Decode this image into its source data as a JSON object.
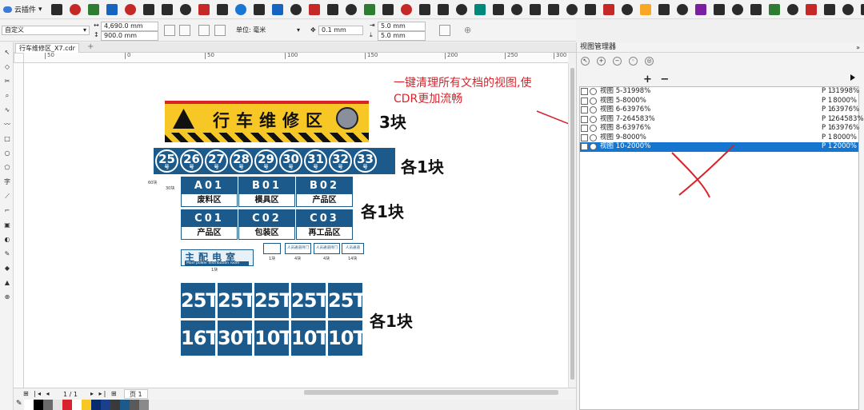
{
  "toolbar": {
    "plugin_label": "云插件",
    "icon_colors": [
      "#2b2b2b",
      "#c62828",
      "#2e7d32",
      "#1565c0",
      "#c62828",
      "#2b2b2b",
      "#2b2b2b",
      "#2b2b2b",
      "#c62828",
      "#2b2b2b",
      "#1976d2",
      "#2b2b2b",
      "#1565c0",
      "#2b2b2b",
      "#c62828",
      "#2b2b2b",
      "#2b2b2b",
      "#2e7d32",
      "#2b2b2b",
      "#c62828",
      "#2b2b2b",
      "#2b2b2b",
      "#2b2b2b",
      "#00897b",
      "#2b2b2b",
      "#2b2b2b",
      "#2b2b2b",
      "#2b2b2b",
      "#2b2b2b",
      "#2b2b2b",
      "#c62828",
      "#2b2b2b",
      "#f9a825",
      "#2b2b2b",
      "#2b2b2b",
      "#7b1fa2",
      "#2b2b2b",
      "#2b2b2b",
      "#2b2b2b",
      "#2e7d32",
      "#2b2b2b",
      "#c62828",
      "#2b2b2b",
      "#2b2b2b",
      "#2b2b2b",
      "#2b2b2b",
      "#2b2b2b",
      "#c62828"
    ]
  },
  "propbar": {
    "preset": "自定义",
    "width": "4,690.0 mm",
    "height": "900.0 mm",
    "unit_label": "单位: 毫米",
    "nudge": "0.1 mm",
    "dup_x": "5.0 mm",
    "dup_y": "5.0 mm"
  },
  "document": {
    "tab": "行车维修区_X7.cdr",
    "ruler_ticks": [
      "50",
      "0",
      "50",
      "100",
      "150",
      "200",
      "250",
      "300"
    ],
    "page_info": "1 / 1",
    "page_tab": "页 1"
  },
  "artwork": {
    "banner_title": "行车维修区",
    "banner_count": "3块",
    "numbers": [
      "25",
      "26",
      "27",
      "28",
      "29",
      "30",
      "31",
      "32",
      "33"
    ],
    "number_suffix": "号",
    "numbers_count": "各1块",
    "mini_left": "60块",
    "mini_right": "30块",
    "plaques": [
      {
        "code": "A01",
        "name": "废料区"
      },
      {
        "code": "B01",
        "name": "模具区"
      },
      {
        "code": "B02",
        "name": "产品区"
      },
      {
        "code": "C01",
        "name": "产品区"
      },
      {
        "code": "C02",
        "name": "包装区"
      },
      {
        "code": "C03",
        "name": "再工品区"
      }
    ],
    "plaques_count": "各1块",
    "power_room_title": "主配电室",
    "power_room_sub": "Main power distribution room",
    "power_room_count": "1块",
    "small_signs": [
      {
        "text": "",
        "count": "1块"
      },
      {
        "text": "人员通道持门",
        "count": "4块"
      },
      {
        "text": "人员通道持门",
        "count": "4块"
      },
      {
        "text": "人员通道",
        "count": "14块"
      }
    ],
    "tonnage": [
      "25T",
      "25T",
      "25T",
      "25T",
      "25T",
      "16T",
      "30T",
      "10T",
      "10T",
      "10T"
    ],
    "tonnage_count": "各1块"
  },
  "annotation": {
    "text": "一键清理所有文档的视图,使CDR更加流畅",
    "color": "#d8232a"
  },
  "docker": {
    "title": "视图管理器",
    "add_remove": "+ −",
    "views": [
      {
        "name": "视图 5-31998%",
        "page": "P 1",
        "zoom": "31998%",
        "selected": false
      },
      {
        "name": "视图 5-8000%",
        "page": "P 1",
        "zoom": "8000%",
        "selected": false
      },
      {
        "name": "视图 6-63976%",
        "page": "P 1",
        "zoom": "63976%",
        "selected": false
      },
      {
        "name": "视图 7-264583%",
        "page": "P 1",
        "zoom": "264583%",
        "selected": false
      },
      {
        "name": "视图 8-63976%",
        "page": "P 1",
        "zoom": "63976%",
        "selected": false
      },
      {
        "name": "视图 9-8000%",
        "page": "P 1",
        "zoom": "8000%",
        "selected": false
      },
      {
        "name": "视图 10-2000%",
        "page": "P 1",
        "zoom": "2000%",
        "selected": true
      }
    ]
  },
  "palette": [
    "#ffffff",
    "#000000",
    "#6b6b6b",
    "#e3e3e3",
    "#d8232a",
    "#ffffff",
    "#f7c825",
    "#0a2a6e",
    "#1b3f8a",
    "#3a3a3a",
    "#1b5a8a",
    "#5a5a5a",
    "#8a8a8a"
  ],
  "colors": {
    "sign_blue": "#1b5a8a",
    "sign_yellow": "#f7c825",
    "selection": "#1676cf"
  }
}
